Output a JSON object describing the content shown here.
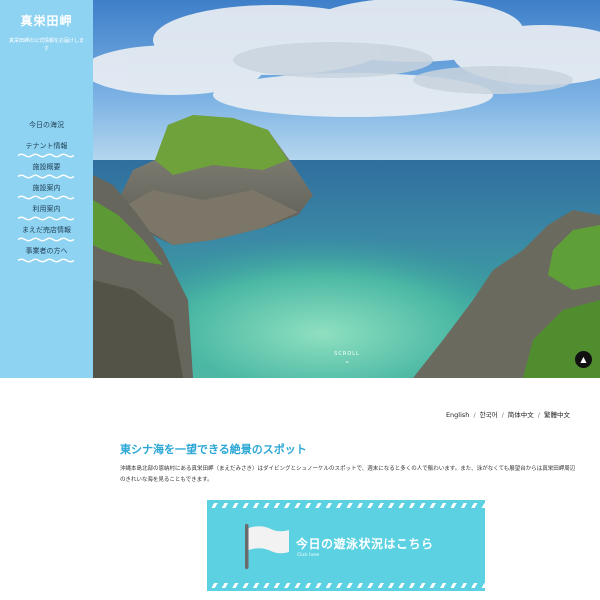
{
  "sidebar": {
    "site_title": "真栄田岬",
    "site_desc": "真栄田岬の公式情報をお届けします",
    "nav": [
      {
        "label": "今日の海況"
      },
      {
        "label": "テナント情報"
      },
      {
        "label": "施設概要"
      },
      {
        "label": "施設案内"
      },
      {
        "label": "利用案内"
      },
      {
        "label": "まえだ売店情報"
      },
      {
        "label": "事業者の方へ"
      }
    ]
  },
  "hero": {
    "scroll_label": "SCROLL",
    "scroll_arrow": "⌄",
    "to_top": "▲"
  },
  "languages": {
    "english": "English",
    "korean": "한국어",
    "chinese_simplified": "简体中文",
    "chinese_traditional": "繁體中文",
    "separator": "/"
  },
  "intro": {
    "heading": "東シナ海を一望できる絶景のスポット",
    "text": "沖縄本島北部の恩納村にある真栄田岬（まえだみさき）はダイビングとシュノーケルのスポットで、週末になると多くの人で賑わいます。また、泳がなくても展望台からは真栄田岬周辺のきれいな海を見ることもできます。"
  },
  "banner": {
    "title": "今日の遊泳状況はこちら",
    "subtitle": "Click here"
  },
  "colors": {
    "sidebar_bg": "#8fd3f2",
    "accent": "#2ba7d6",
    "banner_bg": "#5cd1e2"
  }
}
